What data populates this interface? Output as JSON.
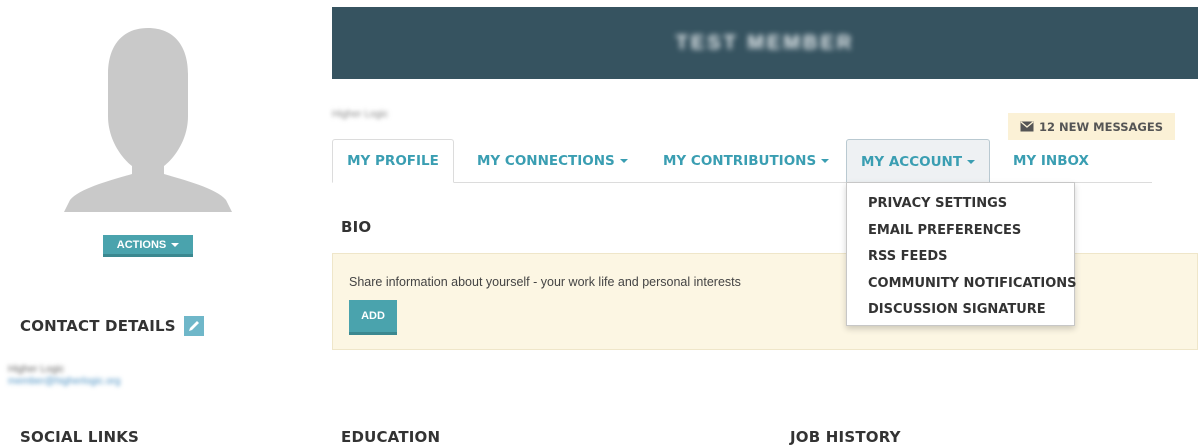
{
  "sidebar": {
    "actions_label": "ACTIONS",
    "contact_heading": "CONTACT DETAILS",
    "contact_org": "Higher Logic",
    "contact_email": "member@higherlogic.org",
    "social_heading": "SOCIAL LINKS"
  },
  "header": {
    "member_name": "TEST MEMBER",
    "org_name": "Higher Logic",
    "messages_label": "12 NEW MESSAGES"
  },
  "tabs": [
    {
      "label": "MY PROFILE"
    },
    {
      "label": "MY CONNECTIONS"
    },
    {
      "label": "MY CONTRIBUTIONS"
    },
    {
      "label": "MY ACCOUNT"
    },
    {
      "label": "MY INBOX"
    }
  ],
  "account_menu": [
    "PRIVACY SETTINGS",
    "EMAIL PREFERENCES",
    "RSS FEEDS",
    "COMMUNITY NOTIFICATIONS",
    "DISCUSSION SIGNATURE"
  ],
  "bio": {
    "heading": "BIO",
    "prompt": "Share information about yourself - your work life and personal interests",
    "add_label": "ADD"
  },
  "sections": {
    "education": "EDUCATION",
    "job_history": "JOB HISTORY"
  },
  "colors": {
    "banner": "#365360",
    "accent": "#3a9eb2",
    "button": "#4aa3ad",
    "bio_bg": "#fcf6e3",
    "badge_bg": "#fbf1d6"
  },
  "icons": [
    "avatar-placeholder",
    "pencil-icon",
    "envelope-icon",
    "caret-down-icon"
  ]
}
